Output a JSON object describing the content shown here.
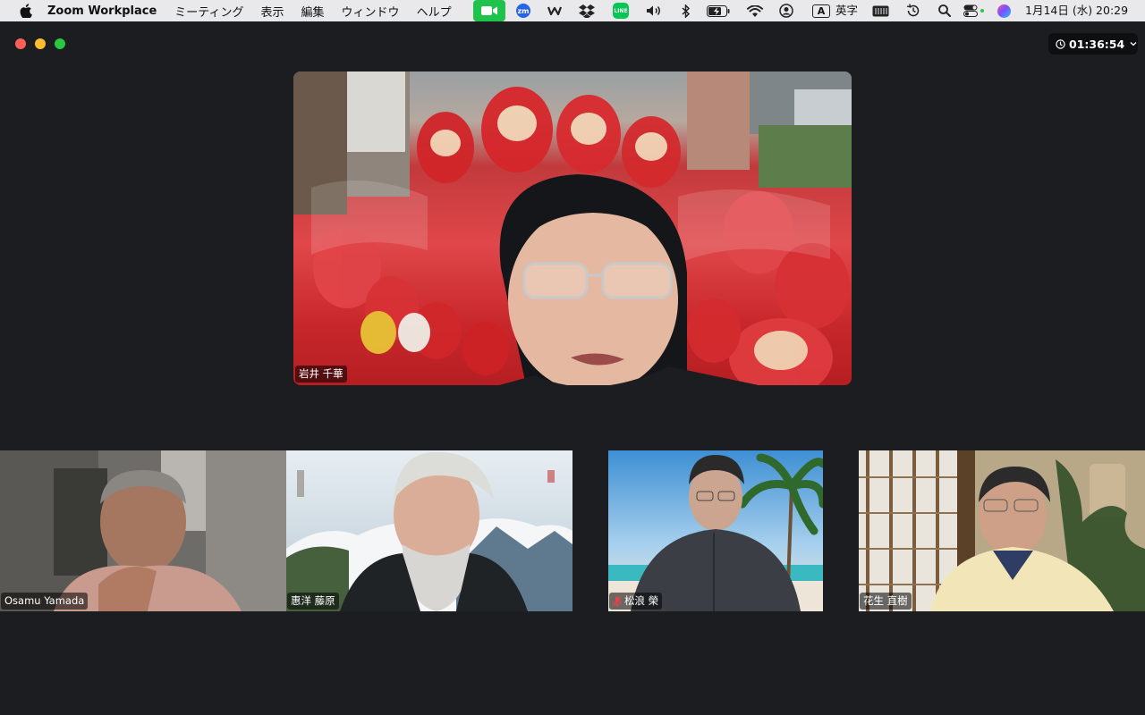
{
  "menubar": {
    "app_name": "Zoom Workplace",
    "menus": [
      "ミーティング",
      "表示",
      "編集",
      "ウィンドウ",
      "ヘルプ"
    ],
    "status_icons": [
      "zoom-video-icon",
      "zm-icon",
      "wave-icon",
      "dropbox-icon",
      "line-icon",
      "volume-icon",
      "bluetooth-icon",
      "battery-icon",
      "wifi-icon",
      "user-icon"
    ],
    "input_method": "英字",
    "input_method_badge": "A",
    "extra_icons": [
      "keyboard-icon",
      "time-machine-icon",
      "search-icon",
      "control-center-icon",
      "siri-icon"
    ],
    "datetime": "1月14日 (水)  20:29",
    "line_label": "LINE",
    "zm_label": "zm"
  },
  "meeting": {
    "elapsed": "01:36:54",
    "main_speaker": {
      "name": "岩井 千華"
    },
    "participants": [
      {
        "name": "Osamu Yamada",
        "muted": false
      },
      {
        "name": "惠洋 藤原",
        "muted": false
      },
      {
        "name": "松浪 榮",
        "muted": true
      },
      {
        "name": "花生 直樹",
        "muted": false
      }
    ]
  },
  "colors": {
    "window_bg": "#1b1d21",
    "menubar_bg": "#e9e8ea",
    "zoom_green": "#1fc34c",
    "mute_red": "#e8414a"
  }
}
